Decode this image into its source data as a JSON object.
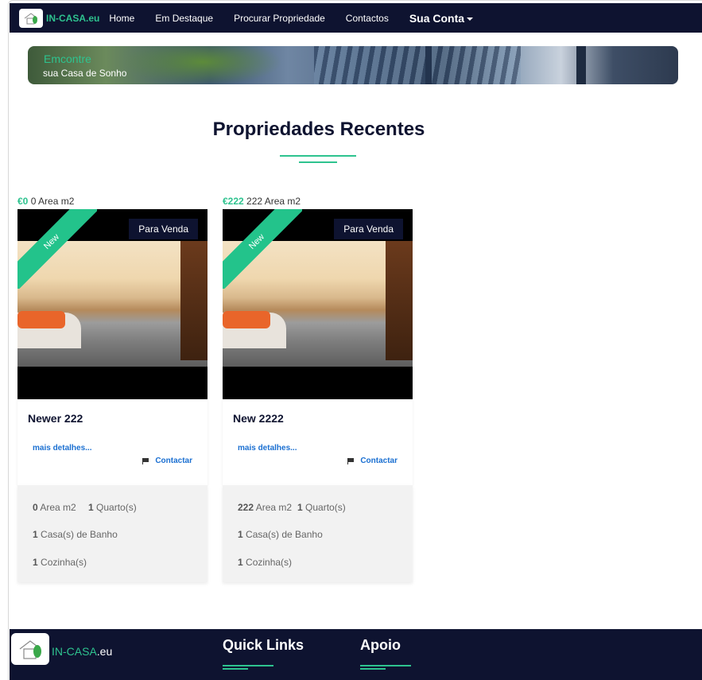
{
  "nav": {
    "brand": "IN-CASA",
    "brand_suffix": ".eu",
    "links": [
      "Home",
      "Em Destaque",
      "Procurar Propriedade",
      "Contactos"
    ],
    "account": "Sua Conta"
  },
  "banner": {
    "line1": "Emcontre",
    "line2": "sua Casa de Sonho"
  },
  "section": {
    "title": "Propriedades Recentes"
  },
  "properties": [
    {
      "price": "€0",
      "area_text": "0 Area m2",
      "ribbon": "New",
      "badge": "Para Venda",
      "title": "Newer 222",
      "details_link": "mais detalhes...",
      "contact_link": "Contactar",
      "area_value": "0",
      "area_unit": "Area m2",
      "rooms_value": "1",
      "rooms_label": "Quarto(s)",
      "baths_value": "1",
      "baths_label": "Casa(s) de Banho",
      "kitchens_value": "1",
      "kitchens_label": "Cozinha(s)"
    },
    {
      "price": "€222",
      "area_text": "222 Area m2",
      "ribbon": "New",
      "badge": "Para Venda",
      "title": "New 2222",
      "details_link": "mais detalhes...",
      "contact_link": "Contactar",
      "area_value": "222",
      "area_unit": "Area m2",
      "rooms_value": "1",
      "rooms_label": "Quarto(s)",
      "baths_value": "1",
      "baths_label": "Casa(s) de Banho",
      "kitchens_value": "1",
      "kitchens_label": "Cozinha(s)"
    }
  ],
  "footer": {
    "brand": "IN-CASA",
    "brand_suffix": ".eu",
    "quick_links": "Quick Links",
    "support": "Apoio"
  },
  "colors": {
    "navy": "#0e1330",
    "accent_green": "#2ec38f",
    "link_blue": "#1a6fd1"
  }
}
